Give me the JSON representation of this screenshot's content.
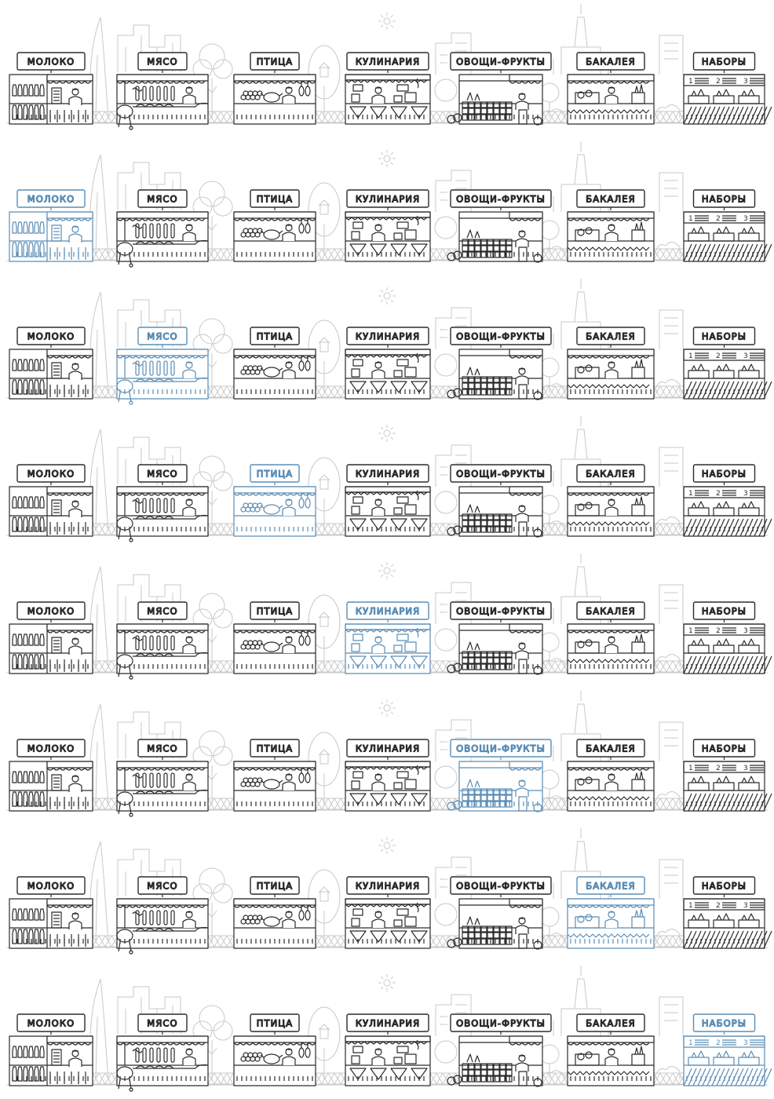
{
  "colors": {
    "active": "#5b8db5",
    "inactive": "#2b2b2b",
    "background_lines": "#c9c9c9",
    "page": "#ffffff"
  },
  "stalls": [
    {
      "id": "milk",
      "label": "МОЛОКО"
    },
    {
      "id": "meat",
      "label": "МЯСО"
    },
    {
      "id": "poultry",
      "label": "ПТИЦА"
    },
    {
      "id": "cookery",
      "label": "КУЛИНАРИЯ"
    },
    {
      "id": "produce",
      "label": "ОВОЩИ-ФРУКТЫ"
    },
    {
      "id": "grocery",
      "label": "БАКАЛЕЯ"
    },
    {
      "id": "sets",
      "label": "НАБОРЫ"
    }
  ],
  "sets_board_numbers": [
    "1",
    "2",
    "3"
  ],
  "rows": [
    {
      "active": null
    },
    {
      "active": "milk"
    },
    {
      "active": "meat"
    },
    {
      "active": "poultry"
    },
    {
      "active": "cookery"
    },
    {
      "active": "produce"
    },
    {
      "active": "grocery"
    },
    {
      "active": "sets"
    }
  ]
}
